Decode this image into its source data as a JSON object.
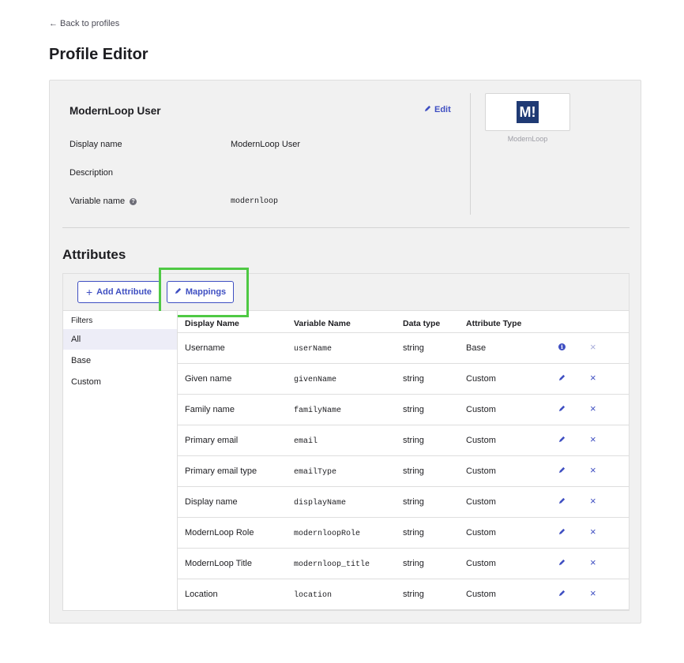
{
  "nav": {
    "back_label": "Back to profiles"
  },
  "page": {
    "title": "Profile Editor"
  },
  "profile": {
    "name": "ModernLoop User",
    "edit_label": "Edit",
    "fields": [
      {
        "label": "Display name",
        "value": "ModernLoop User",
        "mono": false
      },
      {
        "label": "Description",
        "value": "",
        "mono": false
      },
      {
        "label": "Variable name",
        "value": "modernloop",
        "mono": true,
        "help": true
      }
    ],
    "logo": {
      "mark": "M!",
      "caption": "ModernLoop",
      "color": "#1f3a74"
    }
  },
  "attributes": {
    "title": "Attributes",
    "add_button_label": "Add Attribute",
    "mappings_button_label": "Mappings",
    "filters_title": "Filters",
    "filters": [
      {
        "label": "All",
        "active": true
      },
      {
        "label": "Base",
        "active": false
      },
      {
        "label": "Custom",
        "active": false
      }
    ],
    "columns": [
      "Display Name",
      "Variable Name",
      "Data type",
      "Attribute Type"
    ],
    "rows": [
      {
        "display": "Username",
        "variable": "userName",
        "type": "string",
        "attr_type": "Base",
        "action_icon": "info-icon",
        "delete_enabled": false
      },
      {
        "display": "Given name",
        "variable": "givenName",
        "type": "string",
        "attr_type": "Custom",
        "action_icon": "pencil-icon",
        "delete_enabled": true
      },
      {
        "display": "Family name",
        "variable": "familyName",
        "type": "string",
        "attr_type": "Custom",
        "action_icon": "pencil-icon",
        "delete_enabled": true
      },
      {
        "display": "Primary email",
        "variable": "email",
        "type": "string",
        "attr_type": "Custom",
        "action_icon": "pencil-icon",
        "delete_enabled": true
      },
      {
        "display": "Primary email type",
        "variable": "emailType",
        "type": "string",
        "attr_type": "Custom",
        "action_icon": "pencil-icon",
        "delete_enabled": true
      },
      {
        "display": "Display name",
        "variable": "displayName",
        "type": "string",
        "attr_type": "Custom",
        "action_icon": "pencil-icon",
        "delete_enabled": true
      },
      {
        "display": "ModernLoop Role",
        "variable": "modernloopRole",
        "type": "string",
        "attr_type": "Custom",
        "action_icon": "pencil-icon",
        "delete_enabled": true
      },
      {
        "display": "ModernLoop Title",
        "variable": "modernloop_title",
        "type": "string",
        "attr_type": "Custom",
        "action_icon": "pencil-icon",
        "delete_enabled": true
      },
      {
        "display": "Location",
        "variable": "location",
        "type": "string",
        "attr_type": "Custom",
        "action_icon": "pencil-icon",
        "delete_enabled": true
      }
    ]
  },
  "colors": {
    "accent": "#3f4fc2",
    "highlight": "#4fc944",
    "panel_bg": "#f1f1f1"
  }
}
